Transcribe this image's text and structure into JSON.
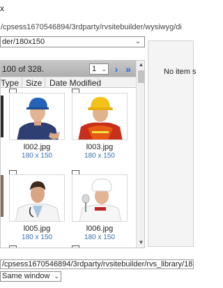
{
  "window": {
    "title_fragment": "x"
  },
  "path_line": "/cpsess1670546894/3rdparty/rvsitebuilder/wysiwyg/di",
  "folder": {
    "selected": "der/180x150"
  },
  "pager": {
    "info": "100 of 328.",
    "page": "1",
    "next_icon": "chevron-right-icon",
    "last_icon": "double-chevron-right-icon"
  },
  "columns": [
    "Type",
    "Size",
    "Date Modified"
  ],
  "files": [
    {
      "name": "l002.jpg",
      "size": "180 x 150"
    },
    {
      "name": "l003.jpg",
      "size": "180 x 150"
    },
    {
      "name": "l005.jpg",
      "size": "180 x 150"
    },
    {
      "name": "l006.jpg",
      "size": "180 x 150"
    }
  ],
  "preview": {
    "empty_text": "No item s"
  },
  "url_field": {
    "value": "/cpsess1670546894/3rdparty/rvsitebuilder/rvs_library/18"
  },
  "target": {
    "selected": "Same window"
  },
  "colors": {
    "pager_nav": "#1e6be0",
    "size_text": "#3a6fb5"
  }
}
